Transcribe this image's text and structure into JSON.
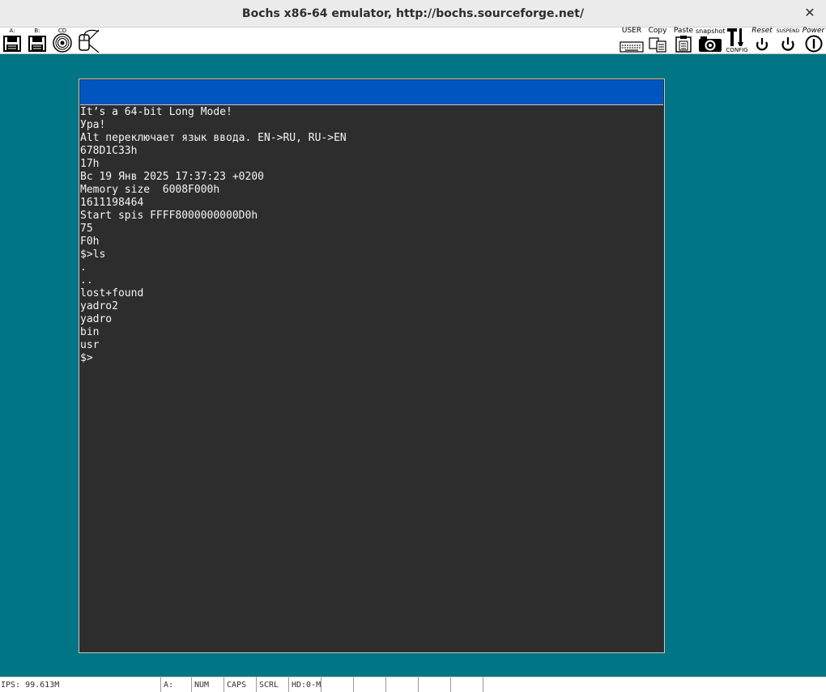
{
  "window": {
    "title": "Bochs x86-64 emulator, http://bochs.sourceforge.net/",
    "close_glyph": "✕"
  },
  "toolbar": {
    "floppy_a_caption": "A:",
    "floppy_b_caption": "B:",
    "cdrom_caption": "CD",
    "user_caption": "USER",
    "copy_caption": "Copy",
    "paste_caption": "Paste",
    "snapshot_caption": "snapshot",
    "config_caption": "CONFIG",
    "reset_caption": "Reset",
    "suspend_caption": "SUSPEND",
    "power_caption": "Power"
  },
  "console": {
    "lines": [
      "It’s a 64-bit Long Mode!",
      "Ура!",
      "Alt переключает язык ввода. EN->RU, RU->EN",
      "678D1C33h",
      "17h",
      "Вс 19 Янв 2025 17:37:23 +0200",
      "Memory size  6008F000h",
      "1611198464",
      "Start spis FFFF8000000000D0h",
      "75",
      "F0h",
      "$>ls",
      ".",
      "..",
      "lost+found",
      "yadro2",
      "yadro",
      "bin",
      "usr",
      "$>"
    ]
  },
  "statusbar": {
    "ips": "IPS: 99.613M",
    "floppy": "A:",
    "num": "NUM",
    "caps": "CAPS",
    "scrl": "SCRL",
    "hd": "HD:0-M"
  },
  "colors": {
    "desktop": "#007585",
    "console_bg": "#2d2d2d",
    "console_header": "#0055c0",
    "console_text": "#f4f4f4"
  }
}
